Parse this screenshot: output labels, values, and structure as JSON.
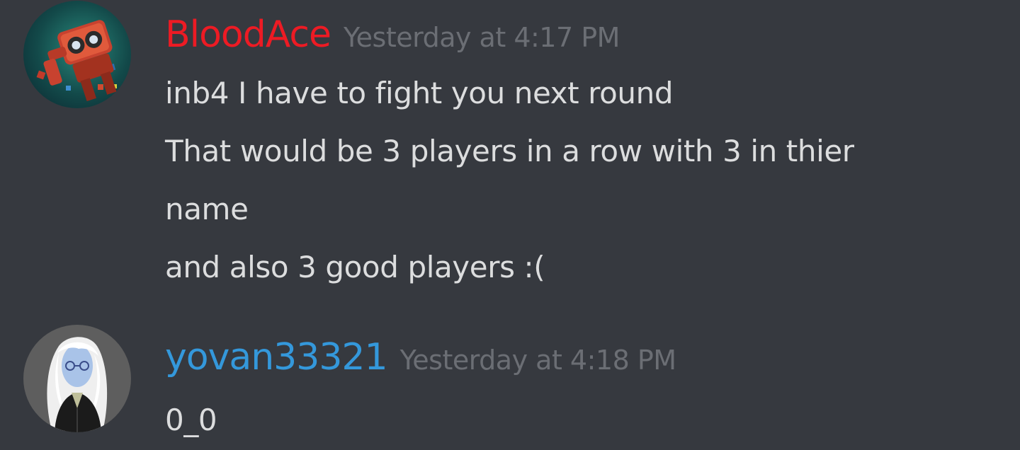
{
  "messages": [
    {
      "avatar_icon": "robot-avatar-icon",
      "username": "BloodAce",
      "username_color": "#ed1b24",
      "timestamp": "Yesterday at 4:17 PM",
      "lines": [
        "inb4 I have to fight you next round",
        "That would be 3 players in a row with 3 in thier",
        "name",
        "and also 3 good players :("
      ]
    },
    {
      "avatar_icon": "white-haired-character-avatar-icon",
      "username": "yovan33321",
      "username_color": "#3498db",
      "timestamp": "Yesterday at 4:18 PM",
      "lines": [
        "0_0"
      ]
    }
  ]
}
